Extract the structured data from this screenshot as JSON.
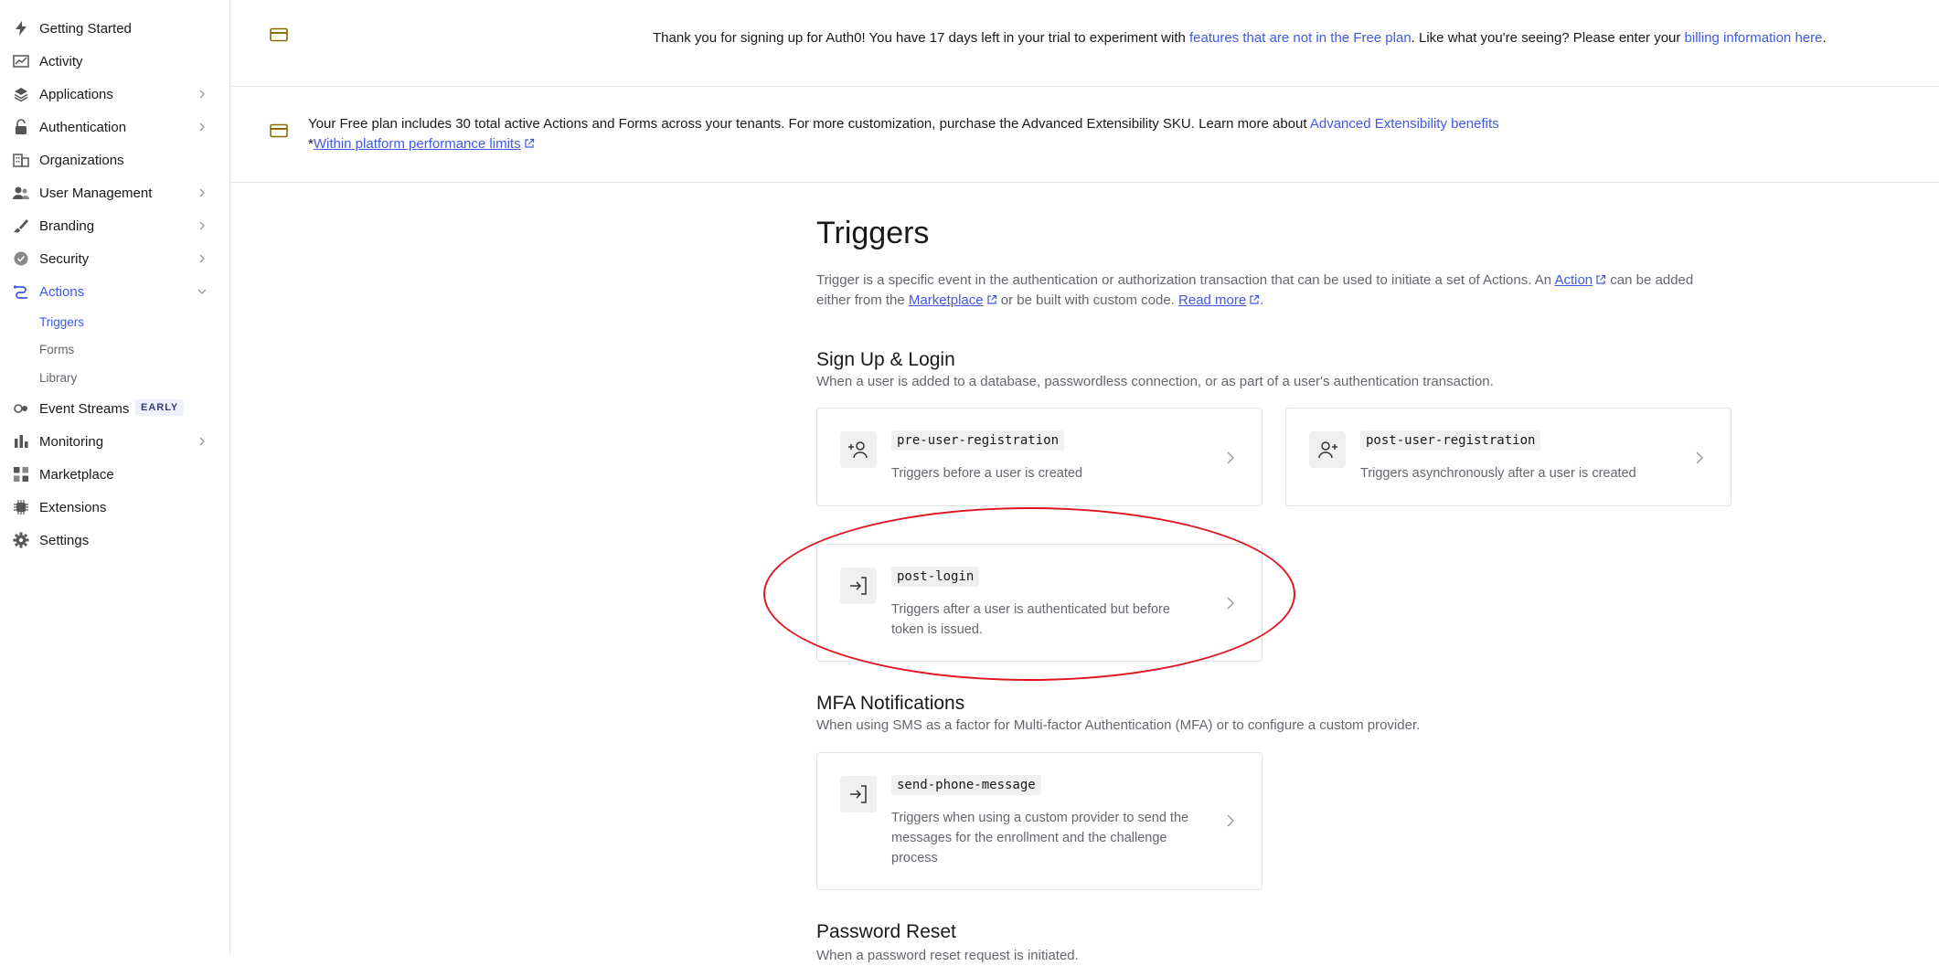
{
  "sidebar": {
    "items": [
      {
        "label": "Getting Started"
      },
      {
        "label": "Activity"
      },
      {
        "label": "Applications"
      },
      {
        "label": "Authentication"
      },
      {
        "label": "Organizations"
      },
      {
        "label": "User Management"
      },
      {
        "label": "Branding"
      },
      {
        "label": "Security"
      },
      {
        "label": "Actions"
      },
      {
        "label": "Event Streams",
        "badge": "EARLY"
      },
      {
        "label": "Monitoring"
      },
      {
        "label": "Marketplace"
      },
      {
        "label": "Extensions"
      },
      {
        "label": "Settings"
      }
    ],
    "actions_subitems": [
      {
        "label": "Triggers"
      },
      {
        "label": "Forms"
      },
      {
        "label": "Library"
      }
    ]
  },
  "trial_banner": {
    "text_before": "Thank you for signing up for Auth0! You have 17 days left in your trial to experiment with ",
    "link1": "features that are not in the Free plan",
    "text_middle": ". Like what you're seeing? Please enter your ",
    "link2": "billing information here",
    "text_after": "."
  },
  "plan_banner": {
    "text": "Your Free plan includes 30 total active Actions and Forms across your tenants. For more customization, purchase the Advanced Extensibility SKU. Learn more about ",
    "link": "Advanced Extensibility benefits",
    "asterisk": "*",
    "limits_link": "Within platform performance limits"
  },
  "main": {
    "title": "Triggers",
    "description": {
      "part1": "Trigger is a specific event in the authentication or authorization transaction that can be used to initiate a set of Actions. An ",
      "action_link": "Action",
      "part2": " can be added",
      "part3": "either from the ",
      "marketplace_link": "Marketplace",
      "part4": " or be built with custom code. ",
      "read_more_link": "Read more",
      "part5": "."
    },
    "sections": [
      {
        "title": "Sign Up & Login",
        "description": "When a user is added to a database, passwordless connection, or as part of a user's authentication transaction.",
        "cards": [
          {
            "name": "pre-user-registration",
            "description": "Triggers before a user is created",
            "icon": "user-plus-icon"
          },
          {
            "name": "post-user-registration",
            "description": "Triggers asynchronously after a user is created",
            "icon": "user-plus-icon"
          },
          {
            "name": "post-login",
            "description": "Triggers after a user is authenticated but before token is issued.",
            "icon": "login-icon"
          }
        ]
      },
      {
        "title": "MFA Notifications",
        "description": "When using SMS as a factor for Multi-factor Authentication (MFA) or to configure a custom provider.",
        "cards": [
          {
            "name": "send-phone-message",
            "description": "Triggers when using a custom provider to send the messages for the enrollment and the challenge process",
            "icon": "login-icon"
          }
        ]
      },
      {
        "title": "Password Reset",
        "description": "When a password reset request is initiated."
      }
    ]
  },
  "colors": {
    "accent": "#3f59e4",
    "annotation": "#e0141e",
    "banner_icon": "#8a6d00"
  }
}
